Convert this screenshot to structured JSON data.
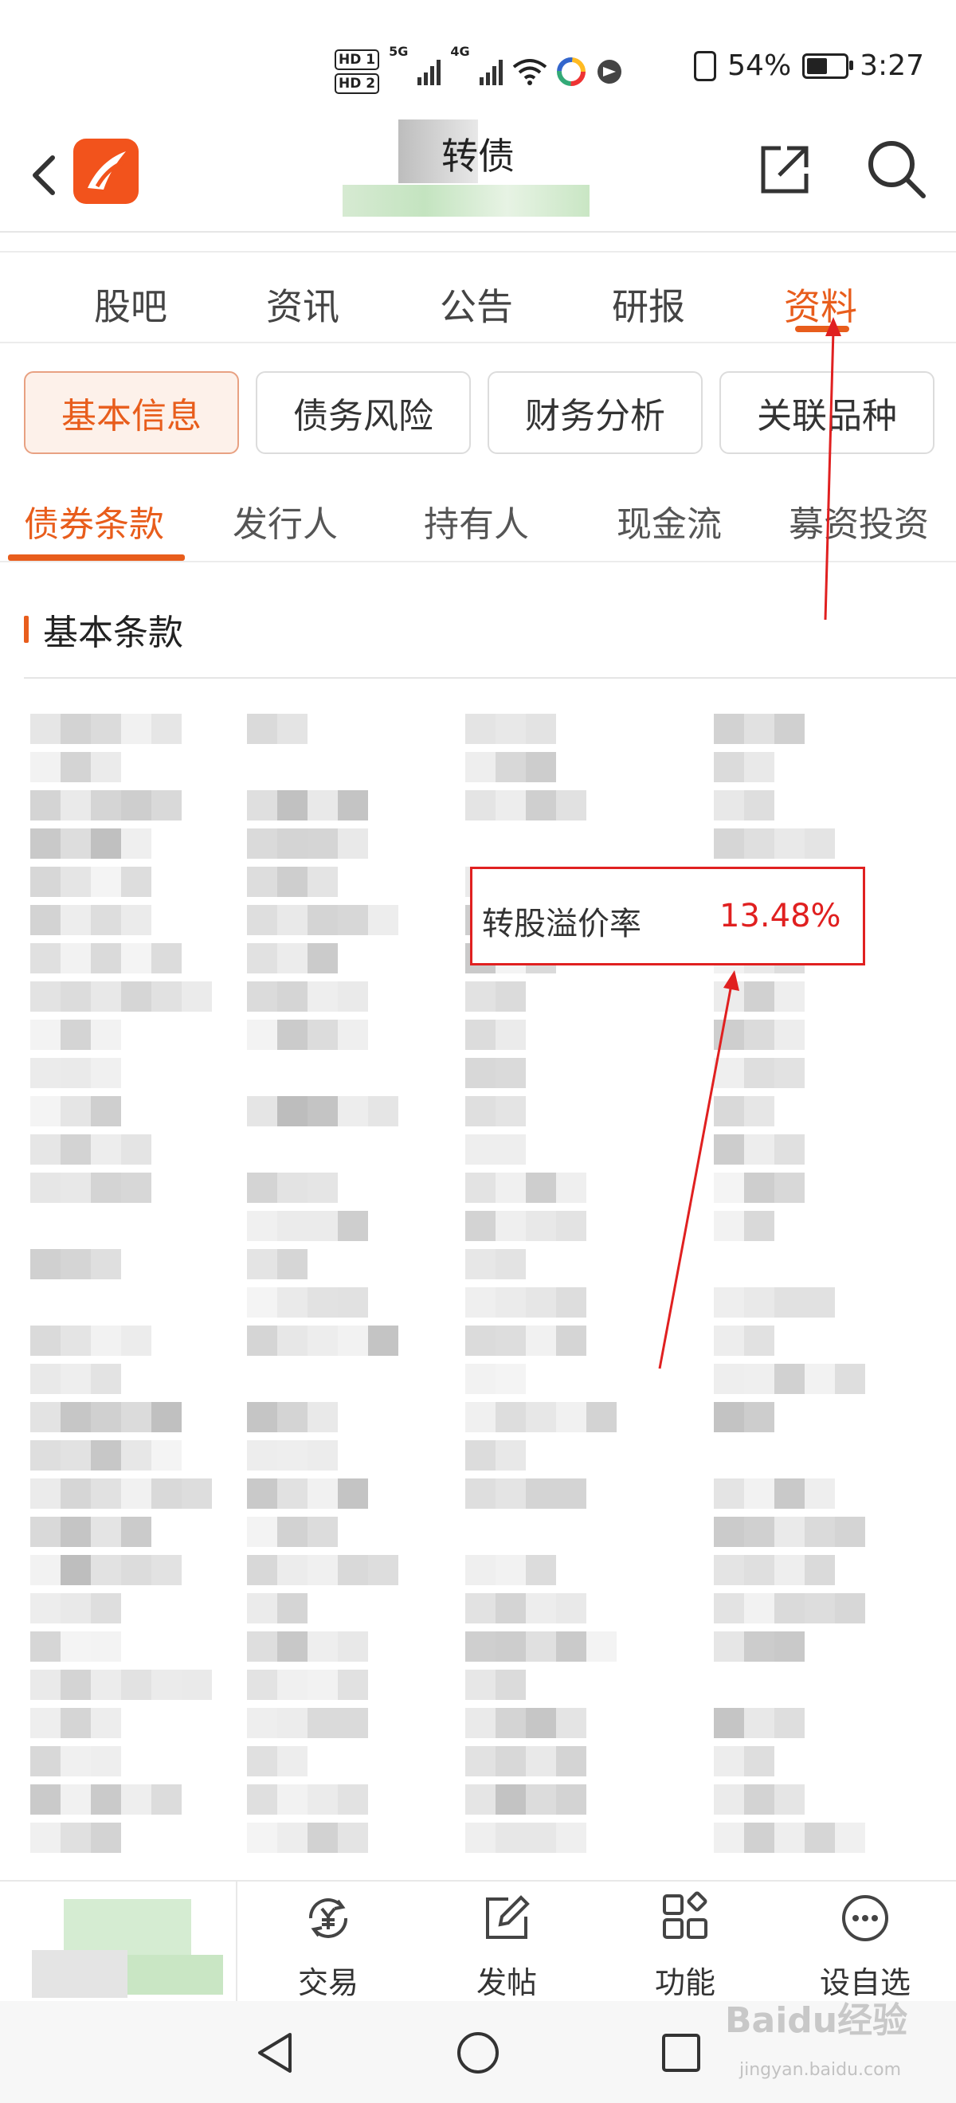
{
  "status_bar": {
    "hd_badges": [
      "HD 1",
      "HD 2"
    ],
    "network_5g": "5G",
    "network_4g": "4G",
    "battery_text": "54%",
    "battery_level": 0.54,
    "time": "3:27",
    "icons": [
      "signal-5g-icon",
      "signal-4g-icon",
      "wifi-icon",
      "app-notification-icon",
      "app-notification-icon",
      "vibrate-icon",
      "battery-icon"
    ]
  },
  "nav": {
    "title": "转债",
    "icons": [
      "back-icon",
      "app-logo-icon",
      "share-icon",
      "search-icon"
    ]
  },
  "main_tabs": [
    {
      "label": "股吧"
    },
    {
      "label": "资讯"
    },
    {
      "label": "公告"
    },
    {
      "label": "研报"
    },
    {
      "label": "资料",
      "active": true
    }
  ],
  "chips": [
    {
      "label": "基本信息",
      "active": true
    },
    {
      "label": "债务风险"
    },
    {
      "label": "财务分析"
    },
    {
      "label": "关联品种"
    }
  ],
  "sub_tabs": [
    {
      "label": "债券条款",
      "active": true
    },
    {
      "label": "发行人"
    },
    {
      "label": "持有人"
    },
    {
      "label": "现金流"
    },
    {
      "label": "募资投资"
    }
  ],
  "section": {
    "title": "基本条款"
  },
  "highlight": {
    "label": "转股溢价率",
    "value": "13.48%",
    "border_color": "#e02020"
  },
  "toolbar": {
    "items": [
      {
        "label": "交易",
        "icon": "trade-yen-icon"
      },
      {
        "label": "发帖",
        "icon": "compose-icon"
      },
      {
        "label": "功能",
        "icon": "grid-icon"
      },
      {
        "label": "设自选",
        "icon": "more-icon"
      }
    ]
  },
  "system_nav": [
    "back-triangle-icon",
    "home-circle-icon",
    "recents-square-icon"
  ],
  "watermark": {
    "main": "Baidu经验",
    "sub": "jingyan.baidu.com"
  },
  "colors": {
    "accent": "#e85d1c",
    "annotation": "#e02020",
    "logo": "#f2531c"
  }
}
